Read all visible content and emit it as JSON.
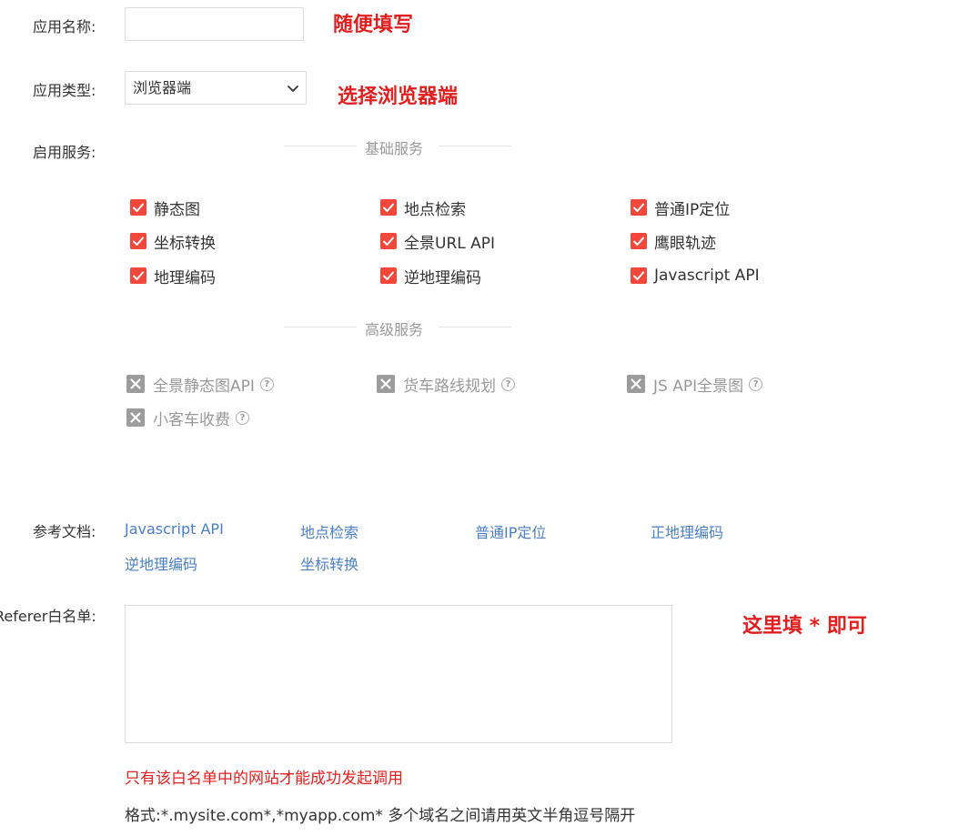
{
  "form": {
    "app_name": {
      "label": "应用名称:",
      "value": "",
      "placeholder": ""
    },
    "app_type": {
      "label": "应用类型:",
      "selected": "浏览器端"
    },
    "services": {
      "label": "启用服务:",
      "basic": {
        "title": "基础服务",
        "items": [
          {
            "label": "静态图",
            "checked": true
          },
          {
            "label": "地点检索",
            "checked": true
          },
          {
            "label": "普通IP定位",
            "checked": true
          },
          {
            "label": "坐标转换",
            "checked": true
          },
          {
            "label": "全景URL API",
            "checked": true
          },
          {
            "label": "鹰眼轨迹",
            "checked": true
          },
          {
            "label": "地理编码",
            "checked": true
          },
          {
            "label": "逆地理编码",
            "checked": true
          },
          {
            "label": "Javascript API",
            "checked": true
          }
        ]
      },
      "advanced": {
        "title": "高级服务",
        "items": [
          {
            "label": "全景静态图API",
            "checked": false,
            "icon": "help-icon"
          },
          {
            "label": "货车路线规划",
            "checked": false,
            "icon": "help-icon"
          },
          {
            "label": "JS API全景图",
            "checked": false,
            "icon": "help-icon"
          },
          {
            "label": "小客车收费",
            "checked": false,
            "icon": "help-icon"
          }
        ]
      }
    },
    "docs": {
      "label": "参考文档:",
      "links": [
        "Javascript API",
        "地点检索",
        "普通IP定位",
        "正地理编码",
        "逆地理编码",
        "坐标转换"
      ]
    },
    "referer": {
      "label": "Referer白名单:",
      "value": "",
      "note": "只有该白名单中的网站才能成功发起调用",
      "format": "格式:*.mysite.com*,*myapp.com* 多个域名之间请用英文半角逗号隔开"
    }
  },
  "annotations": {
    "name_hint": "随便填写",
    "type_hint": "选择浏览器端",
    "referer_hint": "这里填 * 即可"
  },
  "colors": {
    "checkbox": "#f2473a",
    "disabled_box": "#9c9c9c",
    "annotation": "#e02020",
    "link": "#4a7fc1"
  }
}
